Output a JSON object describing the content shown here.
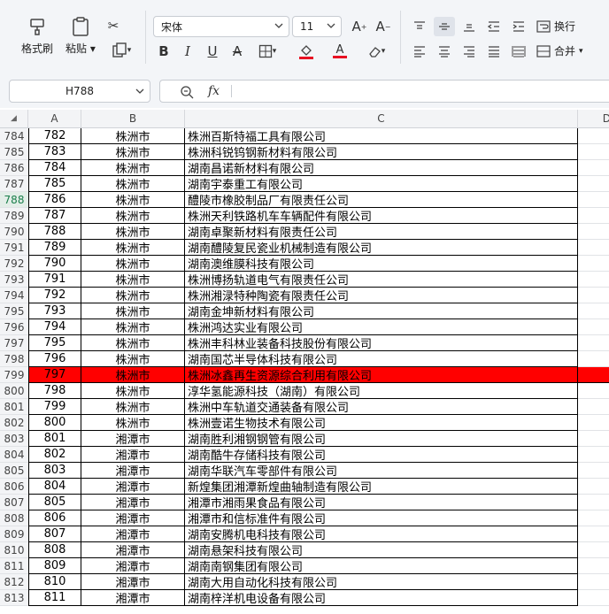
{
  "toolbar": {
    "format_painter": "格式刷",
    "paste": "粘贴",
    "font_name": "宋体",
    "font_size": "11",
    "wrap_text": "换行",
    "merge": "合并"
  },
  "formula_bar": {
    "name_box": "H788",
    "fx": "fx",
    "formula": ""
  },
  "columns": [
    "A",
    "B",
    "C",
    "D"
  ],
  "colors": {
    "highlight": "#ff0000",
    "accent": "#1a7f4b"
  },
  "rows": [
    {
      "n": "784",
      "a": "782",
      "b": "株洲市",
      "c": "株洲百斯特福工具有限公司"
    },
    {
      "n": "785",
      "a": "783",
      "b": "株洲市",
      "c": "株洲科锐钨钢新材料有限公司"
    },
    {
      "n": "786",
      "a": "784",
      "b": "株洲市",
      "c": "湖南昌诺新材料有限公司"
    },
    {
      "n": "787",
      "a": "785",
      "b": "株洲市",
      "c": "湖南宇泰重工有限公司"
    },
    {
      "n": "788",
      "a": "786",
      "b": "株洲市",
      "c": "醴陵市橡胶制品厂有限责任公司"
    },
    {
      "n": "789",
      "a": "787",
      "b": "株洲市",
      "c": "株洲天利铁路机车车辆配件有限公司"
    },
    {
      "n": "790",
      "a": "788",
      "b": "株洲市",
      "c": "湖南卓聚新材料有限责任公司"
    },
    {
      "n": "791",
      "a": "789",
      "b": "株洲市",
      "c": "湖南醴陵复民瓷业机械制造有限公司"
    },
    {
      "n": "792",
      "a": "790",
      "b": "株洲市",
      "c": "湖南澳维膜科技有限公司"
    },
    {
      "n": "793",
      "a": "791",
      "b": "株洲市",
      "c": "株洲博扬轨道电气有限责任公司"
    },
    {
      "n": "794",
      "a": "792",
      "b": "株洲市",
      "c": "株洲湘渌特种陶瓷有限责任公司"
    },
    {
      "n": "795",
      "a": "793",
      "b": "株洲市",
      "c": "湖南金坤新材料有限公司"
    },
    {
      "n": "796",
      "a": "794",
      "b": "株洲市",
      "c": "株洲鸿达实业有限公司"
    },
    {
      "n": "797",
      "a": "795",
      "b": "株洲市",
      "c": "株洲丰科林业装备科技股份有限公司"
    },
    {
      "n": "798",
      "a": "796",
      "b": "株洲市",
      "c": "湖南国芯半导体科技有限公司"
    },
    {
      "n": "799",
      "a": "797",
      "b": "株洲市",
      "c": "株洲冰鑫再生资源综合利用有限公司",
      "highlight": true
    },
    {
      "n": "800",
      "a": "798",
      "b": "株洲市",
      "c": "淳华氢能源科技（湖南）有限公司"
    },
    {
      "n": "801",
      "a": "799",
      "b": "株洲市",
      "c": "株洲中车轨道交通装备有限公司"
    },
    {
      "n": "802",
      "a": "800",
      "b": "株洲市",
      "c": "株洲壹诺生物技术有限公司"
    },
    {
      "n": "803",
      "a": "801",
      "b": "湘潭市",
      "c": "湖南胜利湘钢钢管有限公司"
    },
    {
      "n": "804",
      "a": "802",
      "b": "湘潭市",
      "c": "湖南酷牛存储科技有限公司"
    },
    {
      "n": "805",
      "a": "803",
      "b": "湘潭市",
      "c": "湖南华联汽车零部件有限公司"
    },
    {
      "n": "806",
      "a": "804",
      "b": "湘潭市",
      "c": "新煌集团湘潭新煌曲轴制造有限公司"
    },
    {
      "n": "807",
      "a": "805",
      "b": "湘潭市",
      "c": "湘潭市湘雨果食品有限公司"
    },
    {
      "n": "808",
      "a": "806",
      "b": "湘潭市",
      "c": "湘潭市和信标准件有限公司"
    },
    {
      "n": "809",
      "a": "807",
      "b": "湘潭市",
      "c": "湖南安腾机电科技有限公司"
    },
    {
      "n": "810",
      "a": "808",
      "b": "湘潭市",
      "c": "湖南悬架科技有限公司"
    },
    {
      "n": "811",
      "a": "809",
      "b": "湘潭市",
      "c": "湖南南钢集团有限公司"
    },
    {
      "n": "812",
      "a": "810",
      "b": "湘潭市",
      "c": "湖南大用自动化科技有限公司"
    },
    {
      "n": "813",
      "a": "811",
      "b": "湘潭市",
      "c": "湖南梓洋机电设备有限公司"
    }
  ]
}
